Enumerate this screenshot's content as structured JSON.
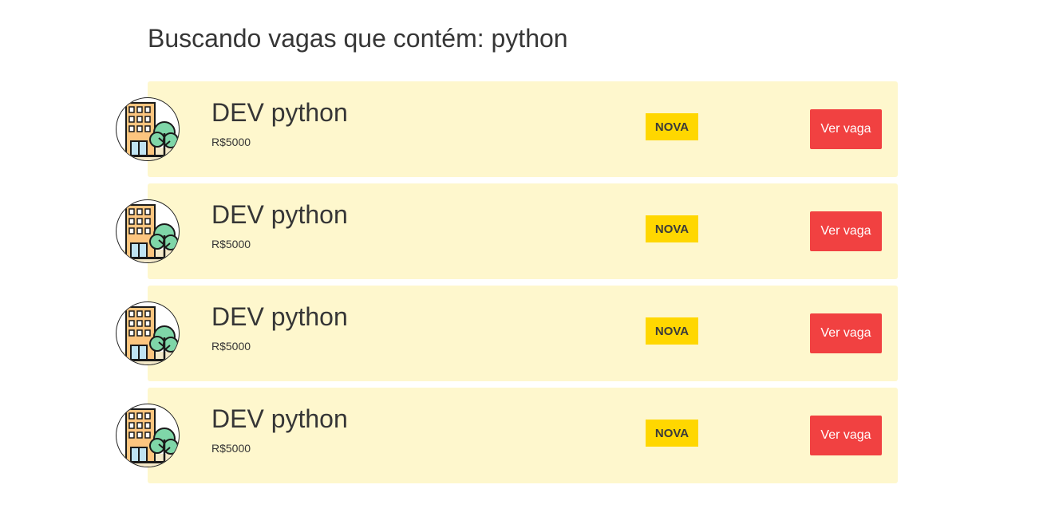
{
  "page": {
    "heading": "Buscando vagas que contém: python"
  },
  "jobs": [
    {
      "title": "DEV python",
      "salary": "R$5000",
      "badge": "NOVA",
      "button_label": "Ver vaga"
    },
    {
      "title": "DEV python",
      "salary": "R$5000",
      "badge": "NOVA",
      "button_label": "Ver vaga"
    },
    {
      "title": "DEV python",
      "salary": "R$5000",
      "badge": "NOVA",
      "button_label": "Ver vaga"
    },
    {
      "title": "DEV python",
      "salary": "R$5000",
      "badge": "NOVA",
      "button_label": "Ver vaga"
    }
  ],
  "icons": {
    "company_logo": "building-with-tree-icon"
  },
  "colors": {
    "card_background": "#fef7cd",
    "badge_background": "#ffd700",
    "button_background": "#f14141",
    "text": "#363636"
  }
}
